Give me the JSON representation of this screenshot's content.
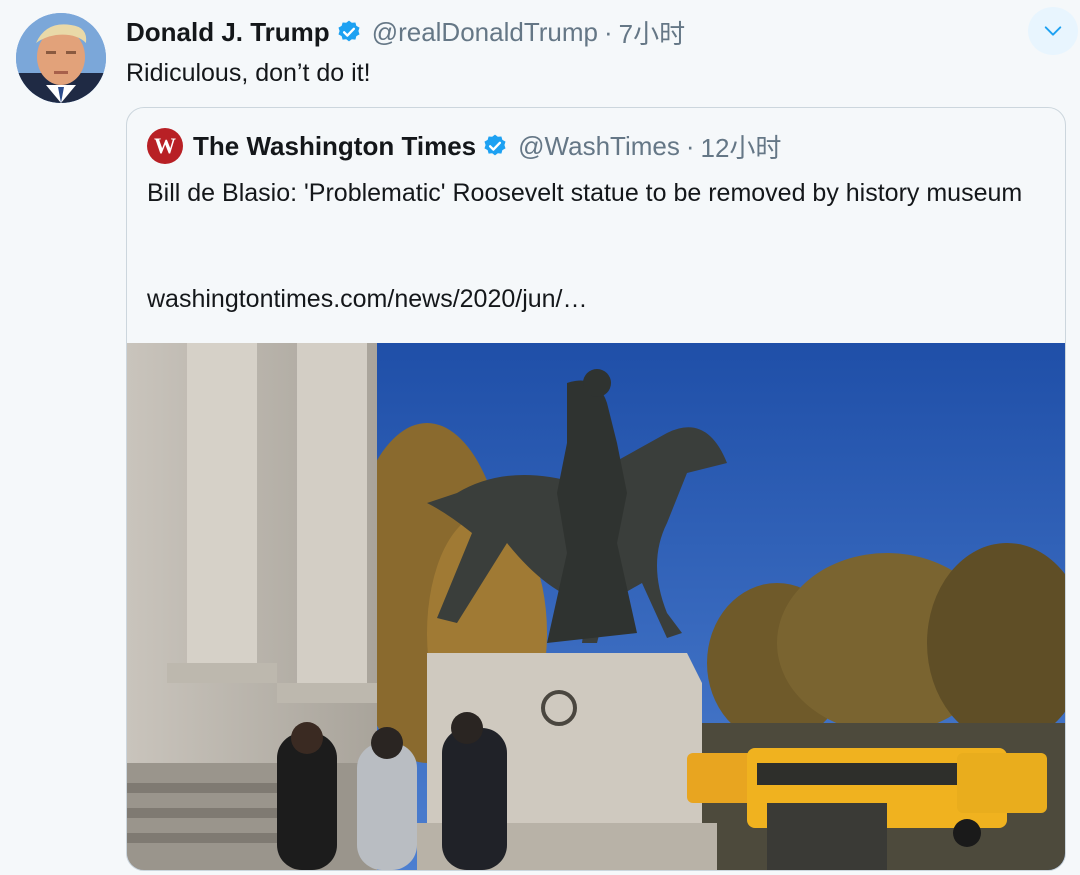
{
  "tweet": {
    "author_name": "Donald J. Trump",
    "author_handle": "@realDonaldTrump",
    "separator": "·",
    "time": "7小时",
    "text": "Ridiculous, don’t do it!",
    "avatar_icon": "profile-photo",
    "verified_icon": "verified-badge-icon",
    "more_icon": "chevron-down-icon"
  },
  "quoted": {
    "author_name": "The Washington Times",
    "author_handle": "@WashTimes",
    "separator": "·",
    "time": "12小时",
    "logo_text": "W",
    "text": "Bill de Blasio: 'Problematic' Roosevelt statue to be removed by history museum",
    "link": "washingtontimes.com/news/2020/jun/…",
    "image_icon": "statue-photo"
  },
  "colors": {
    "background": "#f5f8fa",
    "verified_blue": "#1da1f2",
    "secondary_text": "#657786",
    "border": "#ccd6dd",
    "logo_red": "#b82025"
  }
}
